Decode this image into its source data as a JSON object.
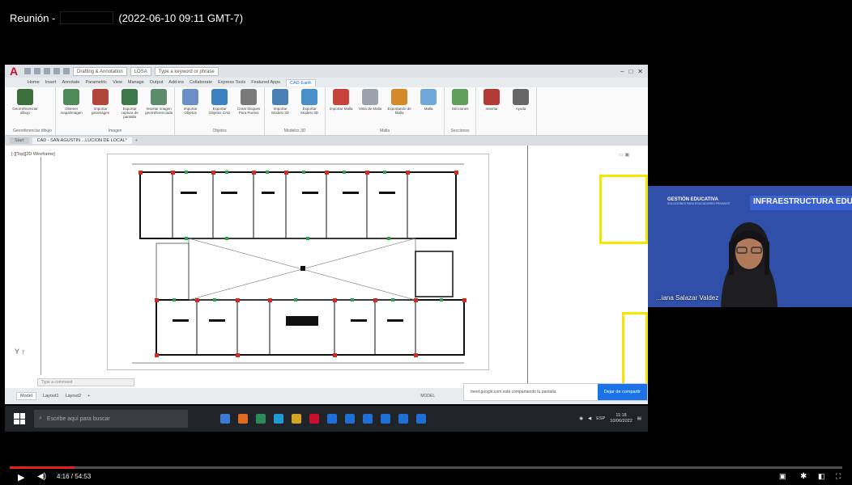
{
  "meeting": {
    "title_prefix": "Reunión -",
    "timestamp": "(2022-06-10 09:11 GMT-7)"
  },
  "autocad": {
    "app_letter": "A",
    "workspace": "Drafting & Annotation",
    "layer": "LOSA",
    "search_placeholder": "Type a keyword or phrase",
    "ribbon_tabs": [
      "Home",
      "Insert",
      "Annotate",
      "Parametric",
      "View",
      "Manage",
      "Output",
      "Add-ins",
      "Collaborate",
      "Express Tools",
      "Featured Apps",
      "CAD-Earth"
    ],
    "active_tab": "CAD-Earth",
    "groups": [
      {
        "title": "Georeferenciar dibujo",
        "tools": [
          {
            "label": "Georreferenciar dibujo",
            "color": "#3b6f3b"
          }
        ]
      },
      {
        "title": "Imagen",
        "tools": [
          {
            "label": "Obtener mapa/imagen",
            "color": "#4c8a5a"
          },
          {
            "label": "Importar geoimagen",
            "color": "#b0463a"
          },
          {
            "label": "Exportar captura de pantalla",
            "color": "#3c7a4a"
          },
          {
            "label": "Insertar imagen georreferenciada",
            "color": "#5d8c6b"
          }
        ]
      },
      {
        "title": "Objetos",
        "tools": [
          {
            "label": "Importar Objetos",
            "color": "#6a8fc8"
          },
          {
            "label": "Exportar Objetos CAD",
            "color": "#3c82c0"
          },
          {
            "label": "Crear bloques Para Puntos",
            "color": "#7a7a7a"
          }
        ]
      },
      {
        "title": "Modelos 3D",
        "tools": [
          {
            "label": "Importar Modelo 3D",
            "color": "#4a7fb5"
          },
          {
            "label": "Exportar Modelo 3D",
            "color": "#4a90c8"
          }
        ]
      },
      {
        "title": "Malla",
        "tools": [
          {
            "label": "Importar Malla",
            "color": "#c8423a"
          },
          {
            "label": "Vista de Malla",
            "color": "#9aa3ad"
          },
          {
            "label": "Exportando de Malla",
            "color": "#d48a2a"
          },
          {
            "label": "Malla",
            "color": "#6fa8d8"
          }
        ]
      },
      {
        "title": "Secciones",
        "tools": [
          {
            "label": "Secciones",
            "color": "#5fa05a"
          }
        ]
      },
      {
        "title": "",
        "tools": [
          {
            "label": "Insertar",
            "color": "#b23a34"
          },
          {
            "label": "Ayuda",
            "color": "#666666"
          }
        ]
      }
    ],
    "doc_tabs": [
      "Start",
      "CAD - SAN AGUSTIN ...LUCION DE LOCAL*"
    ],
    "viewport_label": "[-][Top][2D Wireframe]",
    "command_placeholder": "Type a command",
    "layout_tabs": [
      "Model",
      "Layout1",
      "Layout2"
    ],
    "status_model": "MODEL"
  },
  "screenshare_banner": {
    "message": "meet.google.com está compartiendo tu pantalla.",
    "button": "Dejar de compartir"
  },
  "taskbar": {
    "search_placeholder": "Escribe aquí para buscar",
    "apps": [
      "#3b7bd4",
      "#e06c1f",
      "#2e8b57",
      "#1f9bd4",
      "#d4a31f",
      "#c8102e",
      "#1f6fd4",
      "#1f6fd4",
      "#1f6fd4",
      "#1f6fd4",
      "#1f6fd4",
      "#1f6fd4"
    ],
    "lang": "ESP",
    "time": "11:18",
    "date": "10/06/2022"
  },
  "participant": {
    "org": "GESTIÓN EDUCATIVA",
    "org_sub": "SOLUCIONES PARA EDUCADORES PRIVADOS",
    "program": "INFRAESTRUCTURA EDUCATI",
    "name": "...iana Salazar Valdez"
  },
  "player": {
    "current": "4:16",
    "separator": " / ",
    "duration": "54:53",
    "progress_fraction": 0.078
  }
}
